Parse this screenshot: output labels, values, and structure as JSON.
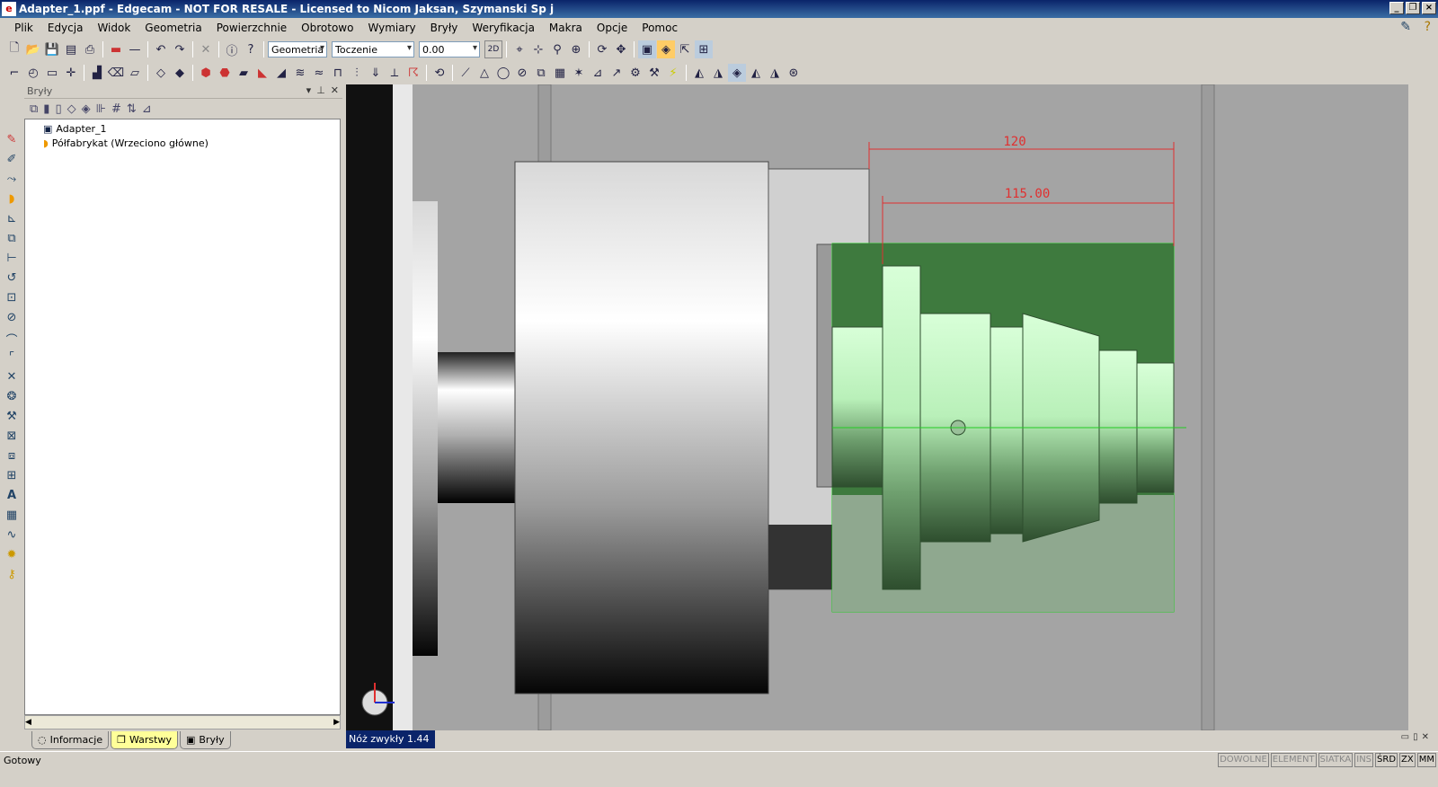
{
  "window": {
    "title": "Adapter_1.ppf - Edgecam - NOT FOR RESALE - Licensed to Nicom Jaksan, Szymanski Sp j"
  },
  "menu": [
    "Plik",
    "Edycja",
    "Widok",
    "Geometria",
    "Powierzchnie",
    "Obrotowo",
    "Wymiary",
    "Bryły",
    "Weryfikacja",
    "Makra",
    "Opcje",
    "Pomoc"
  ],
  "toolbar": {
    "mode_combo": "Geometria",
    "process_combo": "Toczenie",
    "value_combo": "0.00",
    "view_2d": "2D"
  },
  "panel": {
    "title": "Bryły",
    "tree": [
      {
        "label": "Adapter_1",
        "icon": "solid-icon"
      },
      {
        "label": "Półfabrykat (Wrzeciono główne)",
        "icon": "stock-icon"
      }
    ],
    "tabs": [
      {
        "label": "Informacje",
        "icon": "info-bubble-icon"
      },
      {
        "label": "Warstwy",
        "icon": "layers-icon"
      },
      {
        "label": "Bryły",
        "icon": "solids-icon"
      }
    ]
  },
  "viewport": {
    "dimension_1": "120",
    "dimension_2": "115.00",
    "tool_label": "Nóż zwykły 1.44",
    "colors": {
      "background": "#a4a4a4",
      "stock": "#3e7a3e",
      "part": "#b9f0b9",
      "dimension": "#e03030",
      "axis": "#22cc22"
    }
  },
  "status": {
    "text": "Gotowy",
    "indicators": [
      "DOWOLNE",
      "ELEMENT",
      "SIATKA",
      "INS",
      "ŚRD",
      "ZX",
      "MM"
    ]
  }
}
